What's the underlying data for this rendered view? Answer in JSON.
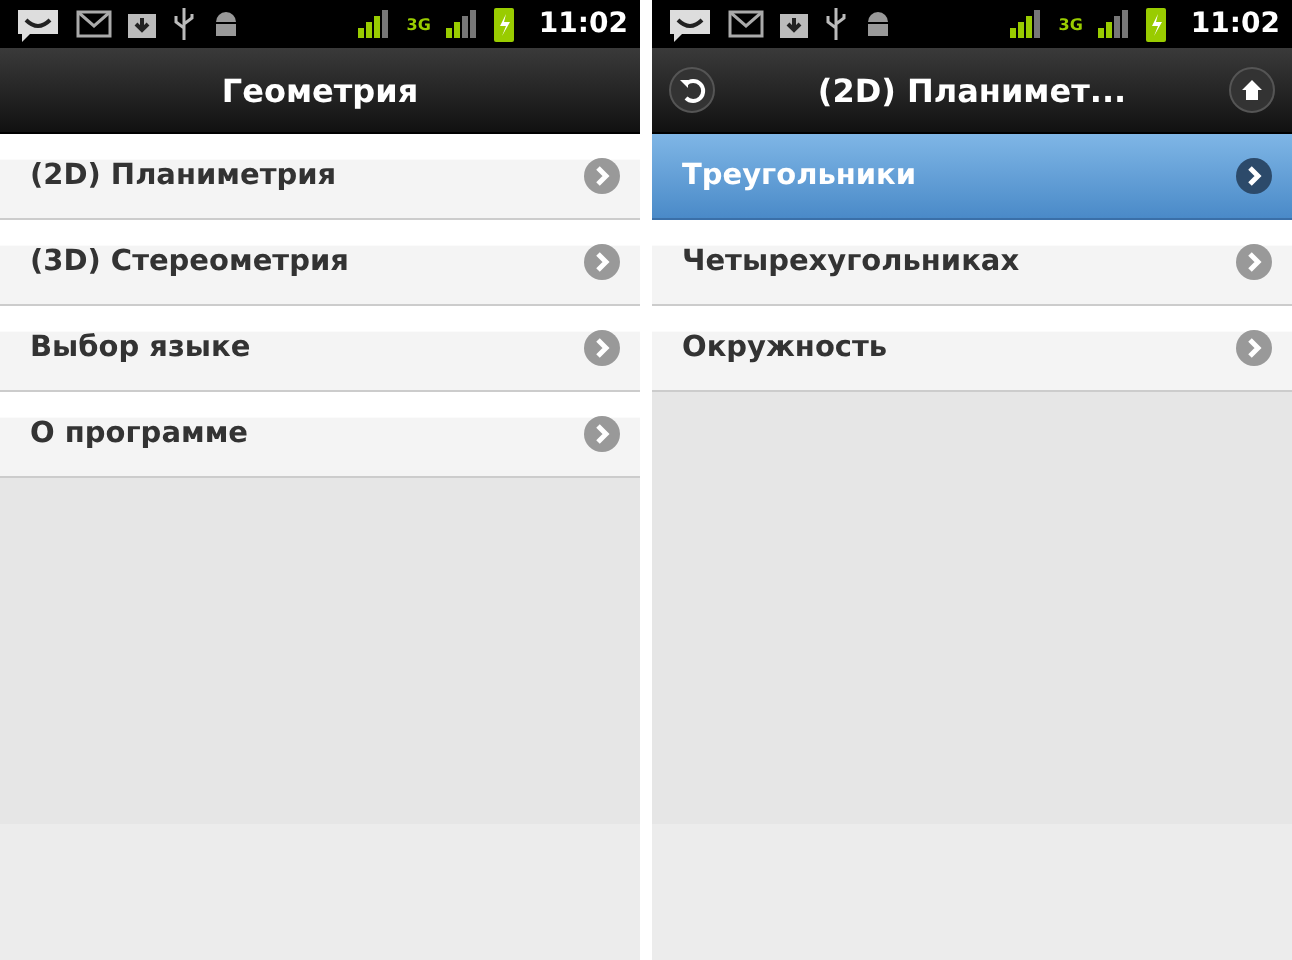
{
  "screens": [
    {
      "status_bar": {
        "network": "3G",
        "time": "11:02"
      },
      "header": {
        "title": "Геометрия"
      },
      "items": [
        {
          "label": "(2D) Планиметрия",
          "selected": false
        },
        {
          "label": "(3D) Стереометрия",
          "selected": false
        },
        {
          "label": "Выбор языке",
          "selected": false
        },
        {
          "label": "О программе",
          "selected": false
        }
      ]
    },
    {
      "status_bar": {
        "network": "3G",
        "time": "11:02"
      },
      "header": {
        "title": "(2D) Планимет...",
        "buttons": [
          {
            "kind": "back"
          },
          {
            "kind": "home"
          }
        ]
      },
      "items": [
        {
          "label": "Треугольники",
          "selected": true
        },
        {
          "label": "Четырехугольниках",
          "selected": false
        },
        {
          "label": "Окружность",
          "selected": false
        }
      ]
    }
  ]
}
